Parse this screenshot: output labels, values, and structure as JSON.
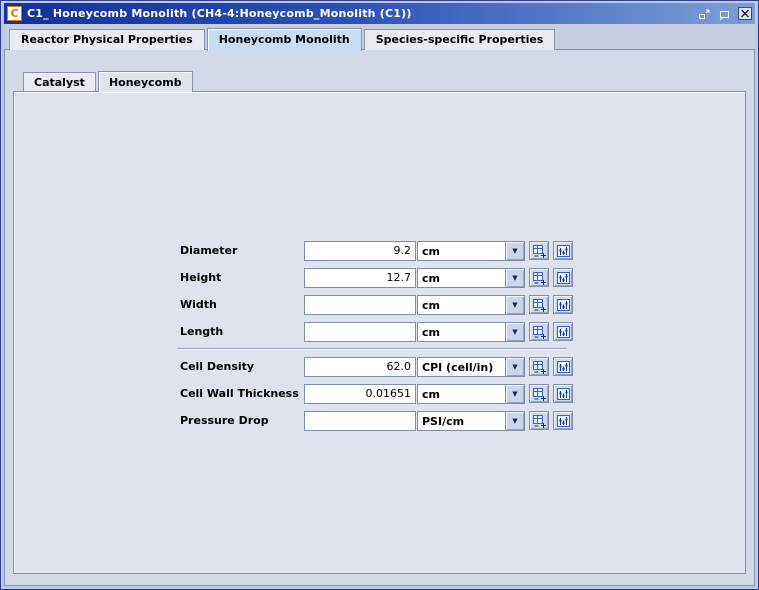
{
  "window": {
    "title": "C1_ Honeycomb Monolith  (CH4-4:Honeycomb_Monolith (C1))",
    "icon_letter": "C"
  },
  "tabs": {
    "outer": [
      {
        "label": "Reactor Physical Properties",
        "selected": false
      },
      {
        "label": "Honeycomb Monolith",
        "selected": true
      },
      {
        "label": "Species-specific Properties",
        "selected": false
      }
    ],
    "inner": [
      {
        "label": "Catalyst",
        "selected": false
      },
      {
        "label": "Honeycomb",
        "selected": true
      }
    ]
  },
  "icons": {
    "dropdown_arrow": "▼"
  },
  "form": {
    "rows": [
      {
        "label": "Diameter",
        "value": "9.2",
        "unit": "cm"
      },
      {
        "label": "Height",
        "value": "12.7",
        "unit": "cm"
      },
      {
        "label": "Width",
        "value": "",
        "unit": "cm"
      },
      {
        "label": "Length",
        "value": "",
        "unit": "cm"
      },
      {
        "label": "Cell Density",
        "value": "62.0",
        "unit": "CPI (cell/in)"
      },
      {
        "label": "Cell Wall Thickness",
        "value": "0.01651",
        "unit": "cm"
      },
      {
        "label": "Pressure Drop",
        "value": "",
        "unit": "PSI/cm"
      }
    ]
  },
  "colors": {
    "titlebar_start": "#14309a",
    "titlebar_end": "#7d9fd8",
    "selected_tab": "#c8dcf4",
    "panel": "#dee3ee",
    "accent_orange": "#e07b00"
  }
}
